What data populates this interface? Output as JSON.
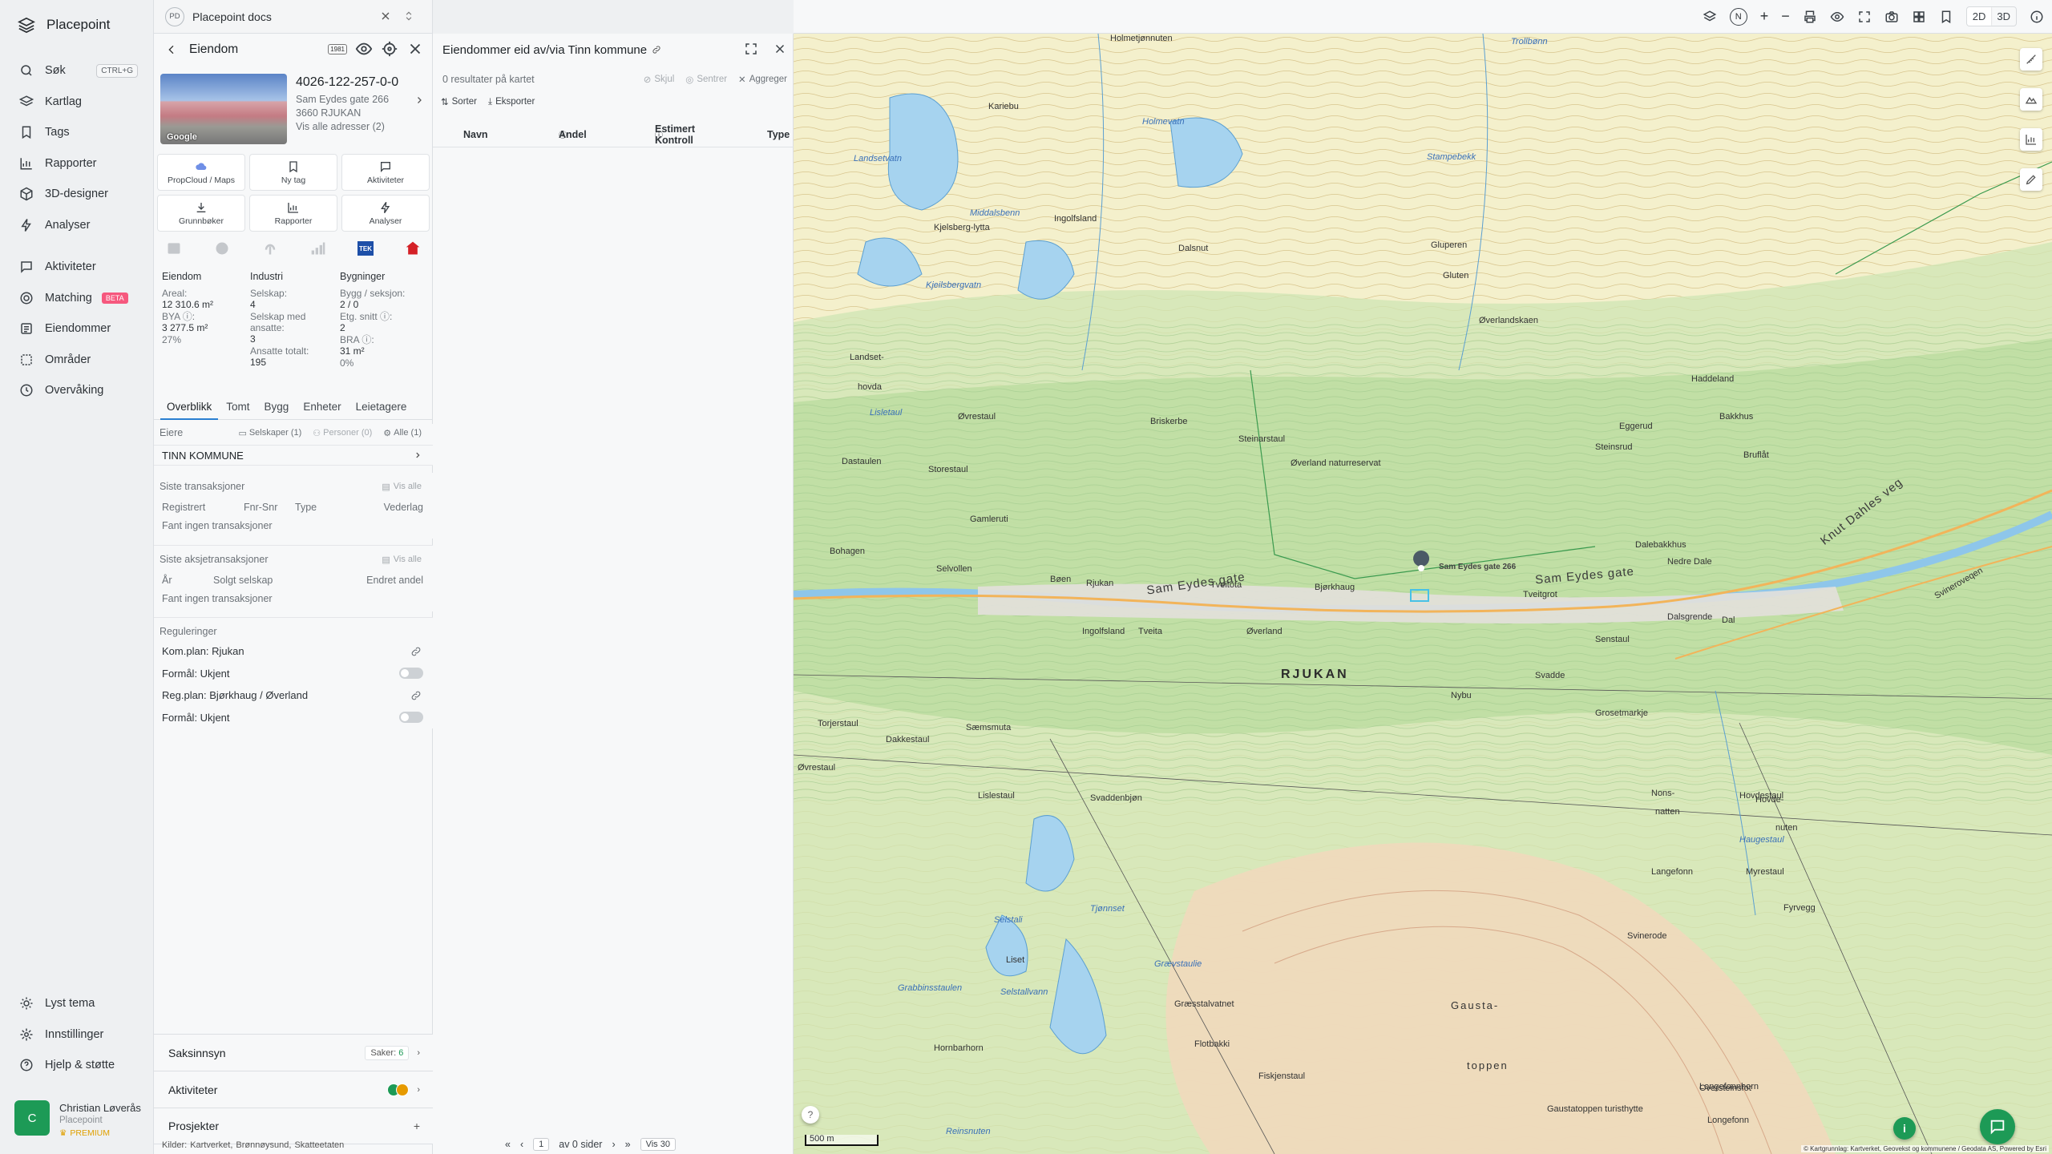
{
  "app": {
    "name": "Placepoint"
  },
  "nav": {
    "items": [
      {
        "label": "Søk",
        "icon": "search-icon",
        "shortcut": "CTRL+G"
      },
      {
        "label": "Kartlag",
        "icon": "layers-icon"
      },
      {
        "label": "Tags",
        "icon": "bookmark-icon"
      },
      {
        "label": "Rapporter",
        "icon": "chart-icon"
      },
      {
        "label": "3D-designer",
        "icon": "cube-icon"
      },
      {
        "label": "Analyser",
        "icon": "bolt-icon"
      }
    ],
    "items2": [
      {
        "label": "Aktiviteter",
        "icon": "chat-icon"
      },
      {
        "label": "Matching",
        "icon": "target-icon",
        "badge": "BETA"
      },
      {
        "label": "Eiendommer",
        "icon": "list-icon"
      },
      {
        "label": "Områder",
        "icon": "area-icon"
      },
      {
        "label": "Overvåking",
        "icon": "clock-icon"
      }
    ],
    "bottom": [
      {
        "label": "Lyst tema",
        "icon": "sun-icon"
      },
      {
        "label": "Innstillinger",
        "icon": "gear-icon"
      },
      {
        "label": "Hjelp & støtte",
        "icon": "help-icon"
      }
    ],
    "user": {
      "initial": "C",
      "name": "Christian Løverås",
      "org": "Placepoint",
      "plan": "PREMIUM"
    }
  },
  "docbar": {
    "badge": "PD",
    "title": "Placepoint docs"
  },
  "property": {
    "header": "Eiendom",
    "photo_label": "Google",
    "id": "4026-122-257-0-0",
    "address": "Sam Eydes gate 266",
    "postal": "3660 RJUKAN",
    "all_addresses": "Vis alle adresser (2)",
    "actions": [
      {
        "label": "PropCloud / Maps",
        "icon": "cloud-icon"
      },
      {
        "label": "Ny tag",
        "icon": "bookmark-icon"
      },
      {
        "label": "Aktiviteter",
        "icon": "chat-icon"
      },
      {
        "label": "Grunnbøker",
        "icon": "download-icon"
      },
      {
        "label": "Rapporter",
        "icon": "chart-icon"
      },
      {
        "label": "Analyser",
        "icon": "bolt-icon"
      }
    ],
    "source_badge": "TEK",
    "stats": {
      "col1": {
        "head": "Eiendom",
        "areal_label": "Areal:",
        "areal": "12 310.6 m²",
        "bya_label": "BYA ⓘ:",
        "bya": "3 277.5 m²",
        "bya_pct": "27%"
      },
      "col2": {
        "head": "Industri",
        "selskap_label": "Selskap:",
        "selskap": "4",
        "ansatte_label": "Selskap med ansatte:",
        "ansatte": "3",
        "total_label": "Ansatte totalt:",
        "total": "195"
      },
      "col3": {
        "head": "Bygninger",
        "bygg_label": "Bygg / seksjon:",
        "bygg": "2 / 0",
        "etg_label": "Etg. snitt ⓘ:",
        "etg": "2",
        "bra_label": "BRA ⓘ:",
        "bra": "31 m²",
        "bra_pct": "0%"
      }
    },
    "tabs": [
      "Overblikk",
      "Tomt",
      "Bygg",
      "Enheter",
      "Leietagere"
    ],
    "eiere": {
      "label": "Eiere",
      "f1": "Selskaper (1)",
      "f2": "Personer (0)",
      "f3": "Alle (1)",
      "owner": "TINN KOMMUNE"
    },
    "tx": {
      "label": "Siste transaksjoner",
      "visalle": "Vis alle",
      "cols": [
        "Registrert",
        "Fnr-Snr",
        "Type",
        "Vederlag"
      ],
      "empty": "Fant ingen transaksjoner"
    },
    "aksje": {
      "label": "Siste aksjetransaksjoner",
      "visalle": "Vis alle",
      "cols": [
        "År",
        "Solgt selskap",
        "Endret andel"
      ],
      "empty": "Fant ingen transaksjoner"
    },
    "reg": {
      "label": "Reguleringer",
      "items": [
        "Kom.plan: Rjukan",
        "Formål: Ukjent",
        "Reg.plan: Bjørkhaug / Øverland",
        "Formål: Ukjent"
      ]
    },
    "saksinnsyn": {
      "label": "Saksinnsyn",
      "saker_label": "Saker:",
      "saker": "6"
    },
    "aktiviteter": {
      "label": "Aktiviteter"
    },
    "prosjekter": {
      "label": "Prosjekter"
    },
    "kilder": {
      "label": "Kilder:",
      "a": "Kartverket,",
      "b": "Brønnøysund,",
      "c": "Skatteetaten"
    }
  },
  "results": {
    "title": "Eiendommer eid av/via Tinn kommune",
    "count": "0 resultater på kartet",
    "opt1": "Skjul",
    "opt2": "Sentrer",
    "opt3": "Aggreger",
    "btn1": "Sorter",
    "btn2": "Eksporter",
    "cols": [
      "Navn",
      "Andel",
      "Estimert Kontroll",
      "Type"
    ],
    "pager": {
      "page": "1",
      "of": "av 0 sider",
      "per": "Vis 30"
    }
  },
  "map": {
    "view2d": "2D",
    "view3d": "3D",
    "north": "N",
    "scale": "500 m",
    "attribution": "© Kartgrunnlag: Kartverket, Geovekst og kommunene / Geodata AS, Powered by Esri",
    "marker_label": "Sam Eydes gate 266",
    "labels": {
      "town": "RJUKAN",
      "road1": "Sam Eydes gate",
      "road2": "Sam Eydes gate",
      "road3": "Knut Dahles veg",
      "road4": "Svineroveqen",
      "gausta1": "Gausta-",
      "gausta2": "toppen"
    },
    "places": [
      "Holmetjønnuten",
      "Trollbønn",
      "Kariebu",
      "Landsetvatn",
      "Holmevatn",
      "Stampebekk",
      "Middalsbenn",
      "Kjelsberg-lytta",
      "Ingolfsland",
      "Dalsnut",
      "Gluperen",
      "Gluten",
      "Kjeilsbergvatn",
      "Øverlandskaen",
      "Landset-",
      "hovda",
      "Lisletaul",
      "Øvrestaul",
      "Briskerbe",
      "Steinarstaul",
      "Eggerud",
      "Steinsrud",
      "Haddeland",
      "Bakkhus",
      "Bruflåt",
      "Dastaulen",
      "Storestaul",
      "Øverland naturreservat",
      "Gamleruti",
      "Bohagen",
      "Selvollen",
      "Bøen",
      "Rjukan",
      "Tveitota",
      "Bjørkhaug",
      "Tveitgrot",
      "Dalebakkhus",
      "Nedre Dale",
      "Dalsgrende",
      "Dal",
      "Senstaul",
      "Svadde",
      "Nybu",
      "Grosetmarkje",
      "Ingolfsland",
      "Øverland",
      "Tveita",
      "Torjerstaul",
      "Dakkestaul",
      "Sæmsmuta",
      "Øvrestaul",
      "Lislestaul",
      "Svaddenbjøn",
      "Nons-",
      "natten",
      "Hovdestaul",
      "Hovde-",
      "nuten",
      "Haugestaul",
      "Langefonn",
      "Myrestaul",
      "Fyrvegg",
      "Svinerode",
      "Selstali",
      "Tjønnset",
      "Liset",
      "Grævstaulie",
      "Grabbinsstaulen",
      "Selstallvann",
      "Græsstalvatnet",
      "Flotbakki",
      "Fiskjenstaul",
      "Hornbarhorn",
      "Reinsnuten",
      "Gaustatoppen turisthytte",
      "Longefonnhorn",
      "Longefonn",
      "Oversteinsfot"
    ]
  }
}
